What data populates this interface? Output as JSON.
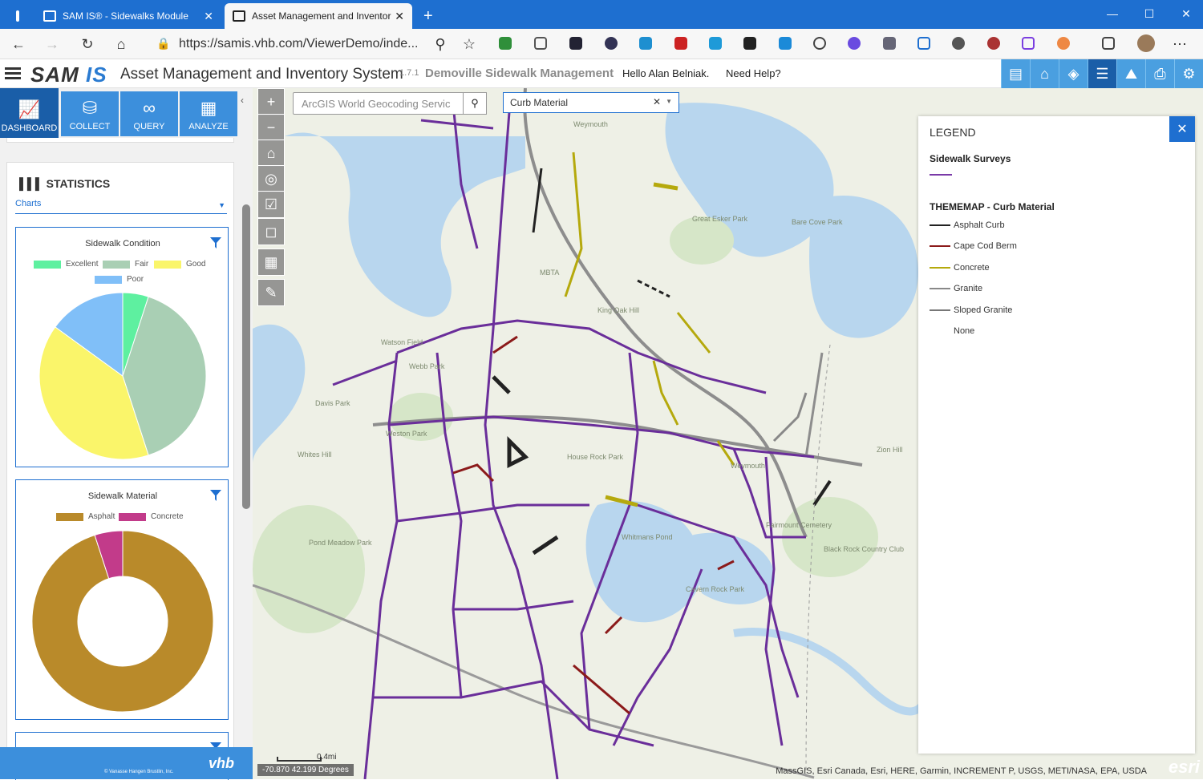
{
  "browser": {
    "tabs": [
      {
        "label": "SAM IS® - Sidewalks Module",
        "active": false
      },
      {
        "label": "Asset Management and Inventor",
        "active": true
      }
    ],
    "new_tab": "+",
    "url": "https://samis.vhb.com/ViewerDemo/inde..."
  },
  "header": {
    "logo_sam": "SAM",
    "logo_is": "IS",
    "title": "Asset Management and Inventory System",
    "version": "1.7.1",
    "subtitle": "Demoville Sidewalk Management",
    "greeting": "Hello Alan Belniak.",
    "help": "Need Help?"
  },
  "nav": {
    "tiles": [
      {
        "label": "DASHBOARD",
        "icon": "chart-line-icon",
        "active": true
      },
      {
        "label": "COLLECT",
        "icon": "database-icon",
        "active": false
      },
      {
        "label": "QUERY",
        "icon": "binoculars-icon",
        "active": false
      },
      {
        "label": "ANALYZE",
        "icon": "calculator-icon",
        "active": false
      }
    ]
  },
  "statistics": {
    "title": "STATISTICS",
    "select_value": "Charts"
  },
  "charts": [
    {
      "title": "Sidewalk Condition",
      "legend": [
        {
          "name": "Excellent",
          "color": "#5ef0a0"
        },
        {
          "name": "Fair",
          "color": "#a9cfb4"
        },
        {
          "name": "Good",
          "color": "#faf56a"
        },
        {
          "name": "Poor",
          "color": "#80bff8"
        }
      ]
    },
    {
      "title": "Sidewalk Material",
      "legend": [
        {
          "name": "Asphalt",
          "color": "#b98a2a"
        },
        {
          "name": "Concrete",
          "color": "#c23b8a"
        }
      ]
    }
  ],
  "chart_data": [
    {
      "type": "pie",
      "title": "Sidewalk Condition",
      "categories": [
        "Excellent",
        "Fair",
        "Good",
        "Poor"
      ],
      "values": [
        5,
        40,
        40,
        15
      ],
      "colors": [
        "#5ef0a0",
        "#a9cfb4",
        "#faf56a",
        "#80bff8"
      ]
    },
    {
      "type": "pie",
      "title": "Sidewalk Material",
      "categories": [
        "Asphalt",
        "Concrete"
      ],
      "values": [
        95,
        5
      ],
      "colors": [
        "#b98a2a",
        "#c23b8a"
      ]
    }
  ],
  "map": {
    "geocoder_placeholder": "ArcGIS World Geocoding Servic",
    "layer_value": "Curb Material",
    "attribution": "MassGIS, Esri Canada, Esri, HERE, Garmin, INCREMENT P, USGS, METI/NASA, EPA, USDA",
    "esri": "esri",
    "coordinates": "-70.870 42.199 Degrees",
    "scale": "0.4mi",
    "labels": [
      "Weymouth",
      "MBTA",
      "King Oak Hill",
      "Great Esker Park",
      "Bare Cove Park",
      "Watson Field",
      "Webb Park",
      "Davis Park",
      "Weston Park",
      "Whites Hill",
      "House Rock Park",
      "Weymouth",
      "Whitmans Pond",
      "Pond Meadow Park",
      "Cavern Rock Park",
      "Fairmount Cemetery",
      "Black Rock Country Club",
      "Zion Hill"
    ]
  },
  "legend": {
    "title": "LEGEND",
    "section1": "Sidewalk Surveys",
    "section1_color": "#7a3aa8",
    "section2": "THEMEMAP - Curb Material",
    "items": [
      {
        "name": "Asphalt Curb",
        "color": "#222222"
      },
      {
        "name": "Cape Cod Berm",
        "color": "#8b1a1a"
      },
      {
        "name": "Concrete",
        "color": "#b5a90d"
      },
      {
        "name": "Granite",
        "color": "#888888"
      },
      {
        "name": "Sloped Granite",
        "color": "#777777"
      },
      {
        "name": "None",
        "color": ""
      }
    ]
  },
  "footer": {
    "copyright": "© Vanasse Hangen Brustlin, Inc.",
    "logo": "vhb"
  }
}
